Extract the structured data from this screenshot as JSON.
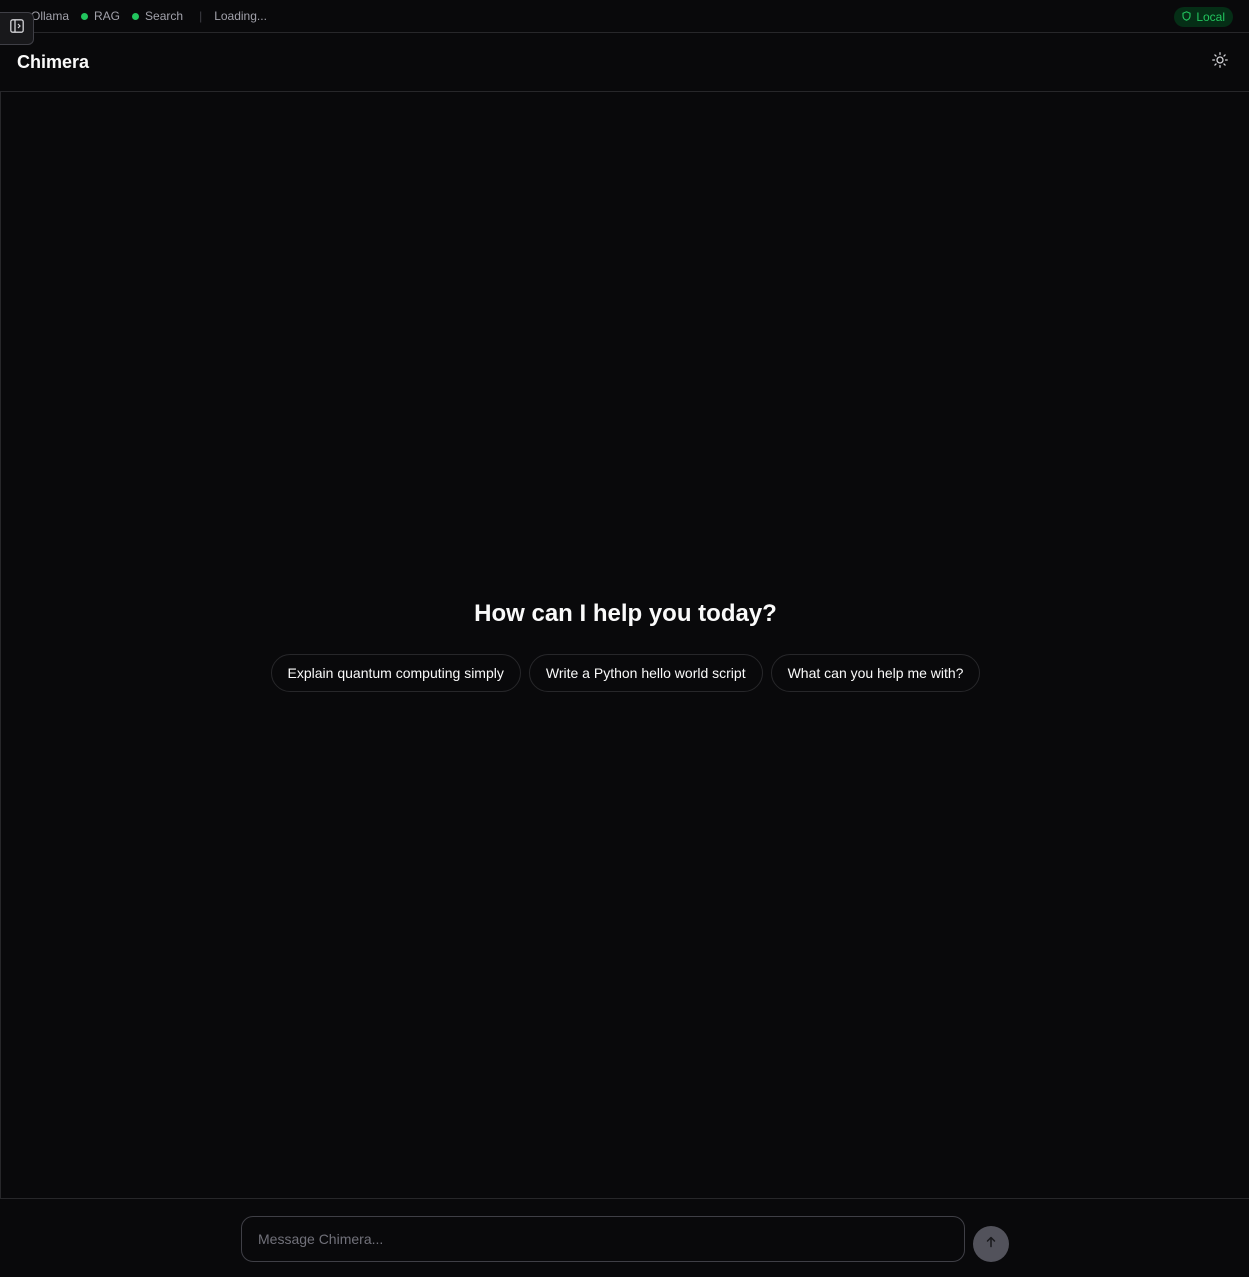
{
  "status_bar": {
    "items": [
      {
        "label": "Ollama",
        "status_color": "#22c55e"
      },
      {
        "label": "RAG",
        "status_color": "#22c55e"
      },
      {
        "label": "Search",
        "status_color": "#22c55e"
      }
    ],
    "loading_text": "Loading...",
    "local_badge": "Local"
  },
  "header": {
    "title": "Chimera",
    "theme_icon": "sun-icon"
  },
  "main": {
    "welcome": "How can I help you today?",
    "suggestions": [
      "Explain quantum computing simply",
      "Write a Python hello world script",
      "What can you help me with?"
    ]
  },
  "composer": {
    "placeholder": "Message Chimera...",
    "send_icon": "arrow-up-icon"
  },
  "colors": {
    "background": "#09090b",
    "accent_green": "#22c55e",
    "border": "#27272a"
  }
}
